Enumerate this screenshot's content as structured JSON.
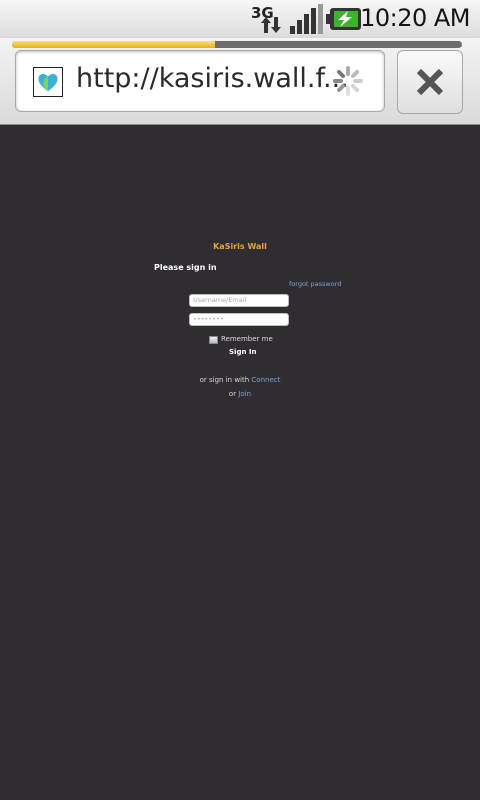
{
  "status_bar": {
    "network_type": "3G",
    "time": "10:20 AM"
  },
  "browser": {
    "url": "http://kasiris.wall.f...",
    "progress_fraction": 0.45,
    "accent": "#e5b11b"
  },
  "page": {
    "site_title": "KaSiris Wall",
    "heading": "Please sign in",
    "forgot_password": "forgot password",
    "username_placeholder": "Username/Email",
    "password_placeholder": "••••••••",
    "remember_me": "Remember me",
    "sign_in": "Sign In",
    "or_sign_in_with": "or sign in with",
    "connect": "Connect",
    "or": "or",
    "join": "Join",
    "background": "#2f2d32",
    "title_color": "#e3a63d",
    "link_color": "#7fa2c9"
  }
}
